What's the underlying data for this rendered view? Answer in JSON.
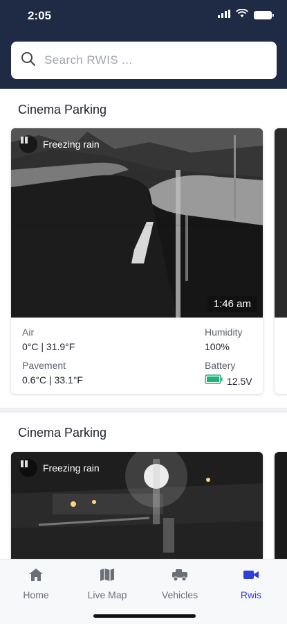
{
  "status_bar": {
    "time": "2:05"
  },
  "search": {
    "placeholder": "Search RWIS ..."
  },
  "stations": [
    {
      "title": "Cinema Parking",
      "camera": {
        "condition": "Freezing rain",
        "timestamp": "1:46 am"
      },
      "air": {
        "label": "Air",
        "value": "0°C | 31.9°F"
      },
      "humidity": {
        "label": "Humidity",
        "value": "100%"
      },
      "pavement": {
        "label": "Pavement",
        "value": "0.6°C | 33.1°F"
      },
      "battery": {
        "label": "Battery",
        "value": "12.5V"
      }
    },
    {
      "title": "Cinema Parking",
      "camera": {
        "condition": "Freezing rain"
      }
    }
  ],
  "nav": {
    "items": [
      {
        "label": "Home",
        "icon": "home-icon"
      },
      {
        "label": "Live Map",
        "icon": "map-icon"
      },
      {
        "label": "Vehicles",
        "icon": "truck-icon"
      },
      {
        "label": "Rwis",
        "icon": "video-camera-icon",
        "active": true
      }
    ]
  },
  "colors": {
    "header_bg": "#1f2a44",
    "accent": "#2f3fd6",
    "battery_green": "#1fb37a"
  }
}
